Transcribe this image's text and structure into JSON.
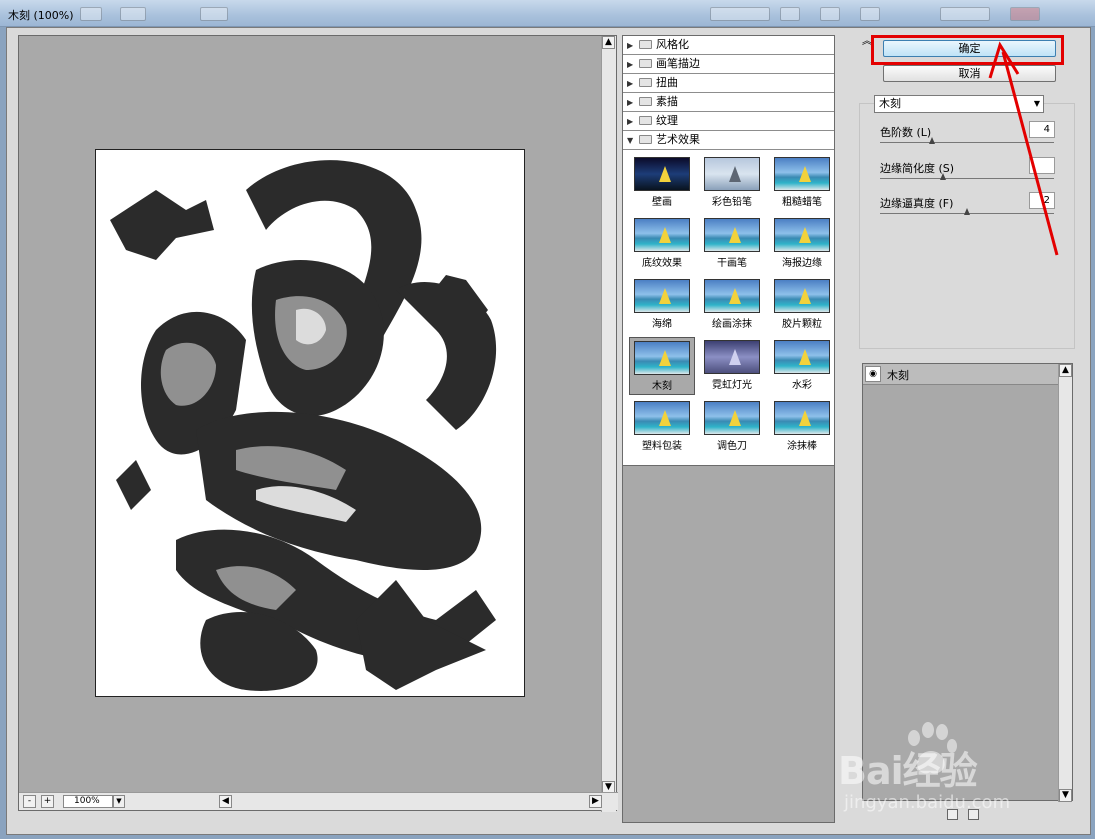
{
  "window": {
    "title": "木刻 (100%)"
  },
  "preview": {
    "zoom": "100%",
    "zoom_out": "-",
    "zoom_in": "+"
  },
  "gallery": {
    "categories": [
      {
        "label": "风格化",
        "expanded": false
      },
      {
        "label": "画笔描边",
        "expanded": false
      },
      {
        "label": "扭曲",
        "expanded": false
      },
      {
        "label": "素描",
        "expanded": false
      },
      {
        "label": "纹理",
        "expanded": false
      },
      {
        "label": "艺术效果",
        "expanded": true
      }
    ],
    "filters": [
      {
        "label": "壁画",
        "style": "dark"
      },
      {
        "label": "彩色铅笔",
        "style": "gray"
      },
      {
        "label": "粗糙蜡笔",
        "style": "normal"
      },
      {
        "label": "底纹效果",
        "style": "normal"
      },
      {
        "label": "干画笔",
        "style": "normal"
      },
      {
        "label": "海报边缘",
        "style": "normal"
      },
      {
        "label": "海绵",
        "style": "normal"
      },
      {
        "label": "绘画涂抹",
        "style": "normal"
      },
      {
        "label": "胶片颗粒",
        "style": "normal"
      },
      {
        "label": "木刻",
        "style": "normal",
        "selected": true
      },
      {
        "label": "霓虹灯光",
        "style": "neon"
      },
      {
        "label": "水彩",
        "style": "normal"
      },
      {
        "label": "塑料包装",
        "style": "normal"
      },
      {
        "label": "调色刀",
        "style": "normal"
      },
      {
        "label": "涂抹棒",
        "style": "normal"
      }
    ]
  },
  "buttons": {
    "ok": "确定",
    "cancel": "取消"
  },
  "settings": {
    "filter_name": "木刻",
    "params": [
      {
        "label": "色阶数 (L)",
        "value": "4",
        "level": 0.3
      },
      {
        "label": "边缘简化度 (S)",
        "value": "",
        "level": 0.36
      },
      {
        "label": "边缘逼真度 (F)",
        "value": "2",
        "level": 0.5
      }
    ]
  },
  "layers": {
    "items": [
      {
        "name": "木刻",
        "visible": true
      }
    ]
  },
  "watermark": {
    "logo": "Bai经验",
    "url": "jingyan.baidu.com"
  },
  "colors": {
    "highlight": "#e30000",
    "panel": "#dadada",
    "canvas_bg": "#a9a9a9"
  }
}
